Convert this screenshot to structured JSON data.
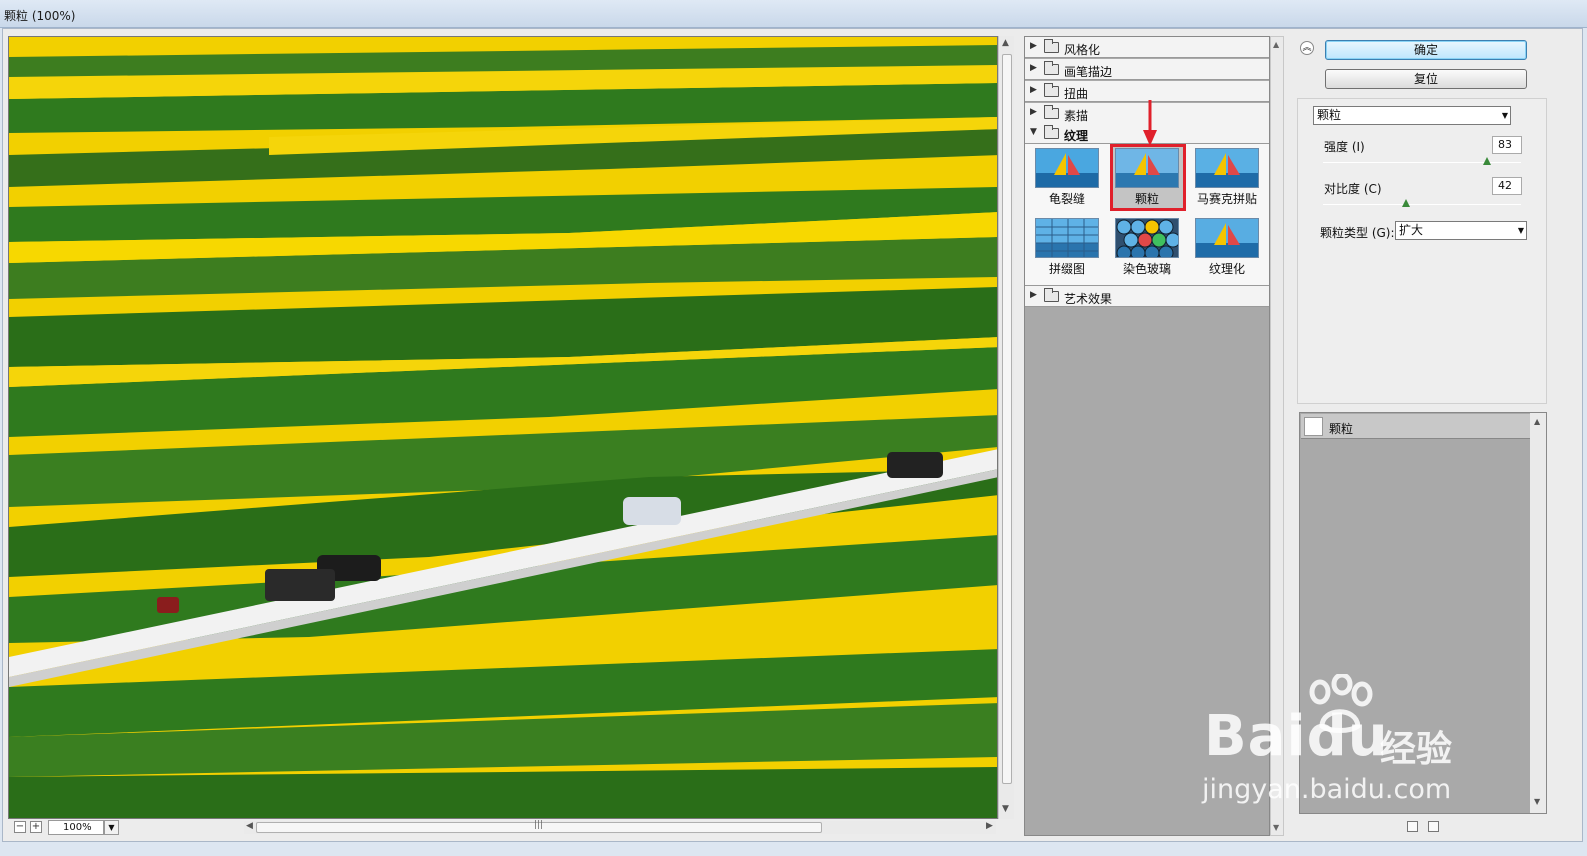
{
  "window": {
    "title": "颗粒 (100%)"
  },
  "preview": {
    "zoom_label": "100%",
    "zoom_out": "−",
    "zoom_in": "+"
  },
  "gallery": {
    "categories": [
      {
        "label": "风格化",
        "expanded": false
      },
      {
        "label": "画笔描边",
        "expanded": false
      },
      {
        "label": "扭曲",
        "expanded": false
      },
      {
        "label": "素描",
        "expanded": false
      },
      {
        "label": "纹理",
        "expanded": true
      },
      {
        "label": "艺术效果",
        "expanded": false
      }
    ],
    "texture_filters": [
      {
        "label": "龟裂缝",
        "selected": false
      },
      {
        "label": "颗粒",
        "selected": true
      },
      {
        "label": "马赛克拼贴",
        "selected": false
      },
      {
        "label": "拼缀图",
        "selected": false
      },
      {
        "label": "染色玻璃",
        "selected": false
      },
      {
        "label": "纹理化",
        "selected": false
      }
    ]
  },
  "options": {
    "ok_label": "确定",
    "reset_label": "复位",
    "filter_select": "颗粒",
    "intensity": {
      "label": "强度 (I)",
      "value": "83",
      "level": 83
    },
    "contrast": {
      "label": "对比度 (C)",
      "value": "42",
      "level": 42
    },
    "grain_type": {
      "label": "颗粒类型 (G):",
      "value": "扩大"
    }
  },
  "layers": {
    "items": [
      {
        "label": "颗粒"
      }
    ]
  },
  "watermark": {
    "brand": "Bai",
    "brand_tail": "du",
    "brand_cn": "经验",
    "url": "jingyan.baidu.com"
  },
  "colors": {
    "selection_border": "#e0202b",
    "rapeseed_yellow": "#f2d000",
    "field_green": "#2f7a1e"
  }
}
